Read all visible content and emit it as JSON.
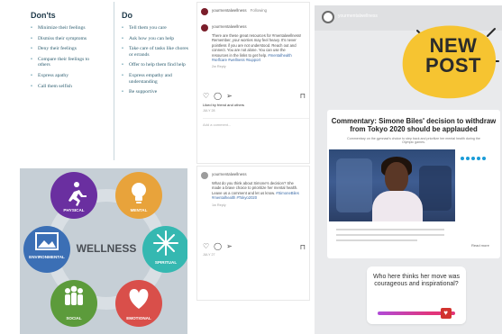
{
  "dos_donts": {
    "donts_title": "Don'ts",
    "donts": [
      "Minimize their feelings",
      "Dismiss their symptoms",
      "Deny their feelings",
      "Compare their feelings to others",
      "Express apathy",
      "Call them selfish"
    ],
    "do_title": "Do",
    "dos": [
      "Tell them you care",
      "Ask how you can help",
      "Take care of tasks like chores or errands",
      "Offer to help them find help",
      "Express empathy and understanding",
      "Be supportive"
    ]
  },
  "wellness": {
    "center": "WELLNESS",
    "segments": [
      {
        "label": "PHYSICAL",
        "color": "#6a2fa0"
      },
      {
        "label": "MENTAL",
        "color": "#e8a33b"
      },
      {
        "label": "SPIRITUAL",
        "color": "#35b8b1"
      },
      {
        "label": "EMOTIONAL",
        "color": "#d94f4a"
      },
      {
        "label": "SOCIAL",
        "color": "#5c9b3b"
      },
      {
        "label": "ENVIRONMENTAL",
        "color": "#3b6fb5"
      }
    ]
  },
  "instagram": {
    "username": "yourmentalwellness",
    "follow": "Following",
    "comment1": "There are these great resources for #mentalwellness! Remember, your worries may feel heavy. It's never pointless if you are not understood. Reach out and connect. You are not alone. You can use the resources in the links to get help.",
    "comment1_tags": "#mentalhealth #selfcare #wellness #support",
    "comment1_meta": "2w  Reply",
    "likes1": "Liked by friend and others",
    "date1": "JULY 28",
    "add_comment": "Add a comment...",
    "comment2": "What do you think about Simone's decision? She made a brave choice to prioritize her mental health. Leave us a comment and let us know.",
    "comment2_tags": "#SimoneBiles #mentalhealth #Tokyo2020",
    "comment2_meta": "1w  Reply",
    "date2": "JULY 27"
  },
  "story": {
    "new_post": "NEW POST",
    "headline": "Commentary: Simone Biles' decision to withdraw from Tokyo 2020 should be applauded",
    "subhead": "Commentary on the gymnast's choice to step back and prioritize her mental health during the Olympic games.",
    "read_more": "Read more",
    "question": "Who here thinks her move was courageous and inspirational?",
    "slider_level": 0.88,
    "slider_emoji": "heart-emoji"
  }
}
